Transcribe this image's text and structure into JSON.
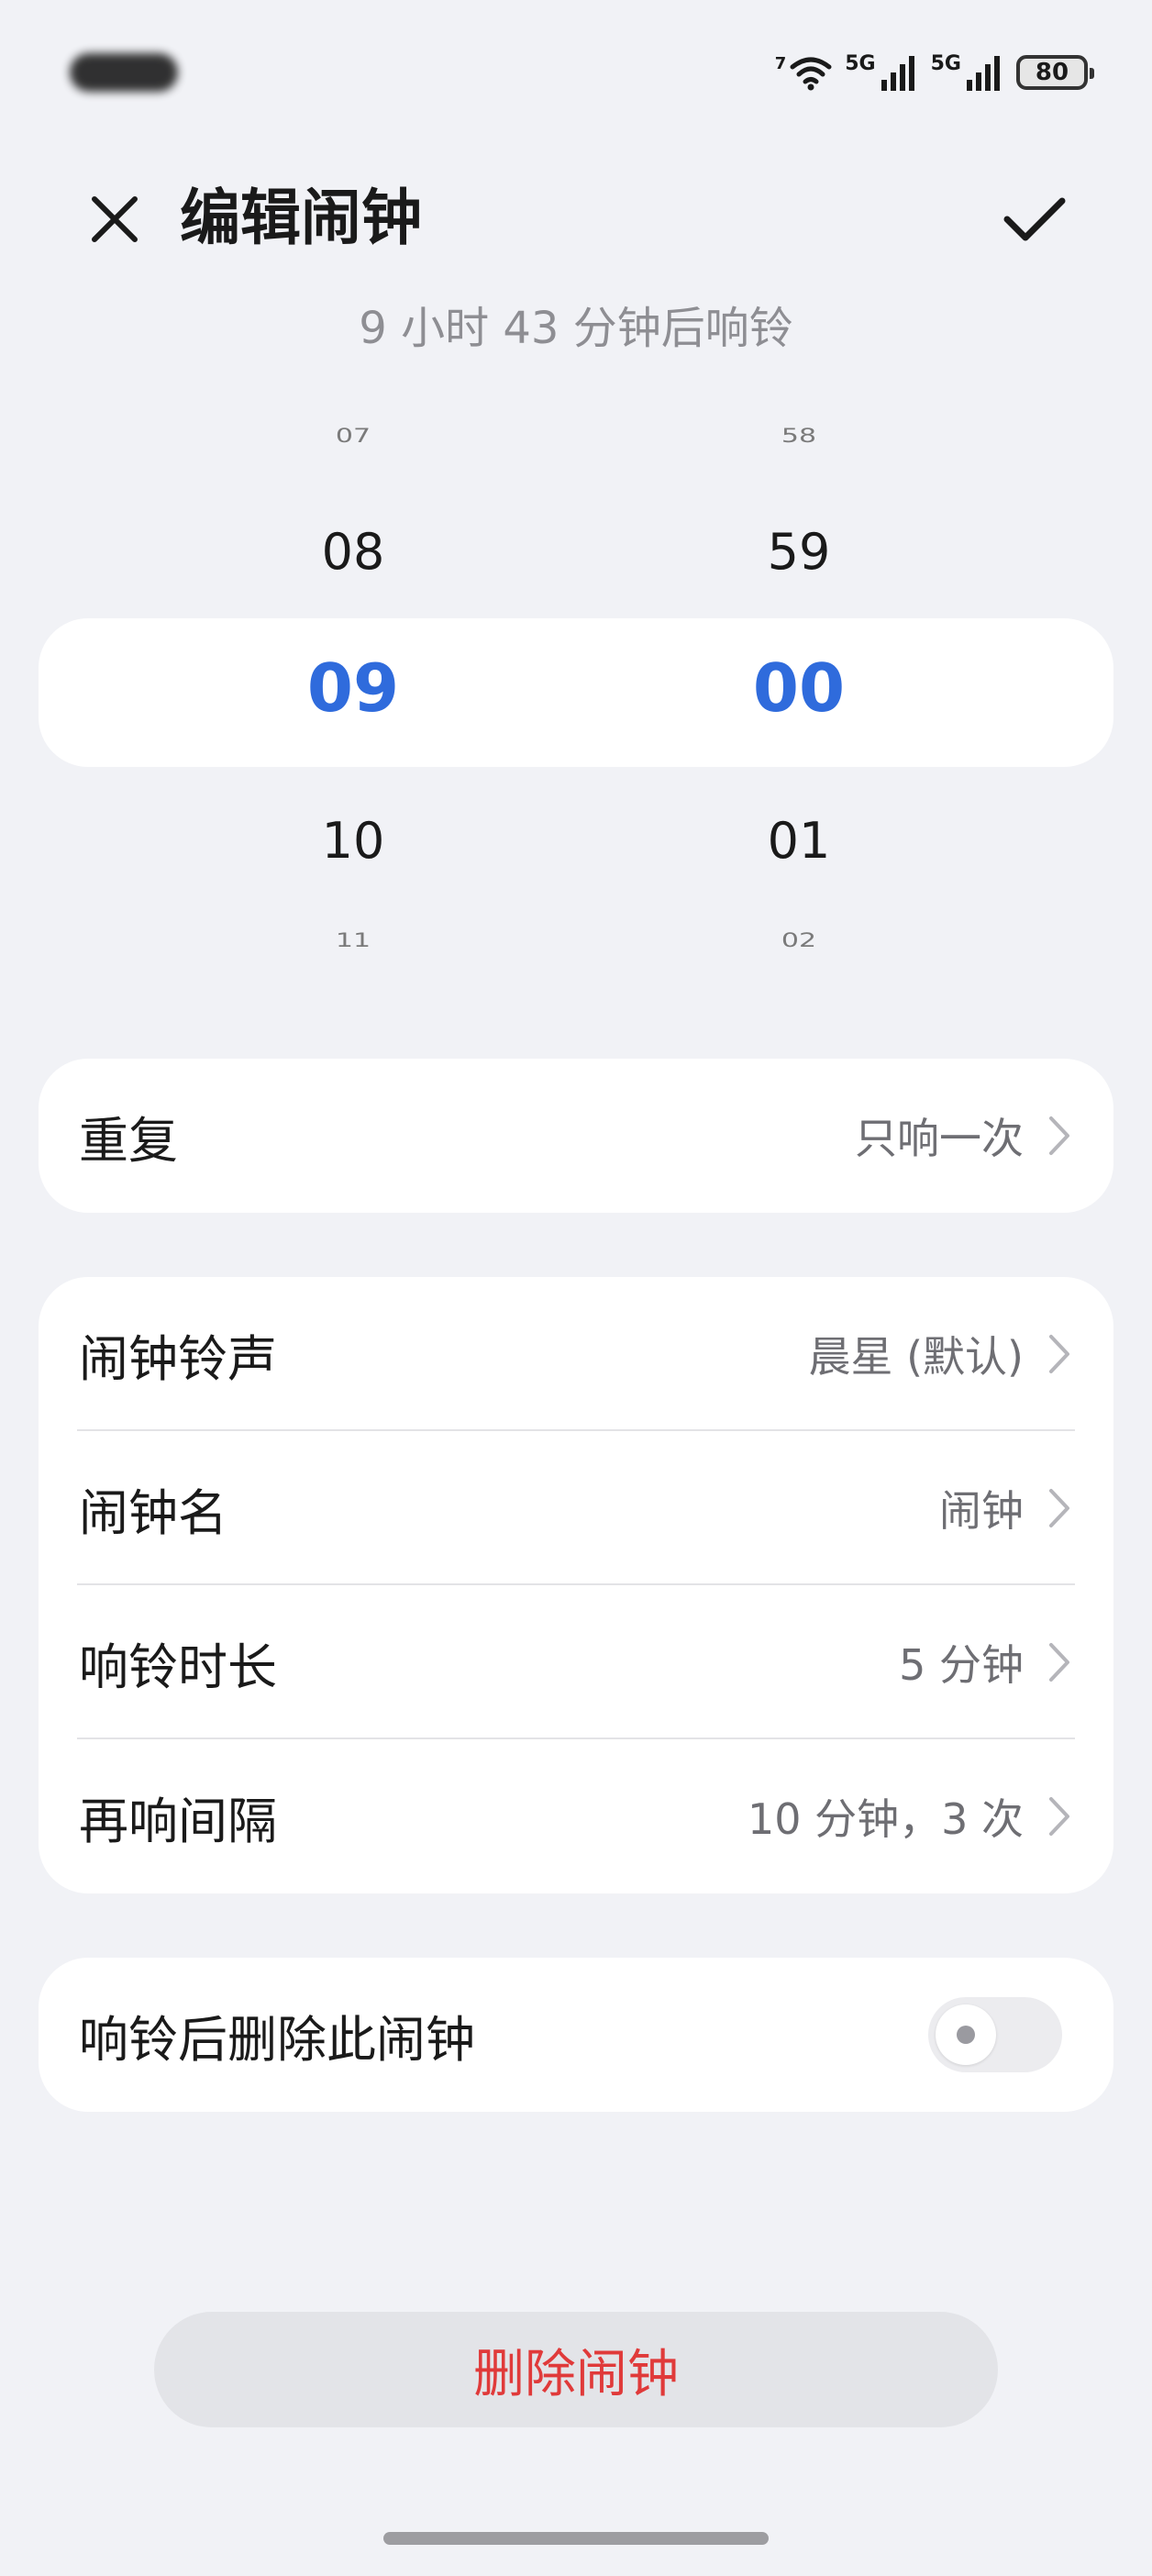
{
  "status_bar": {
    "battery": "80",
    "wifi_badge": "7",
    "sim1_label": "5G",
    "sim2_label": "5G",
    "icons": [
      "wifi-icon",
      "signal-icon",
      "signal-icon",
      "battery-icon"
    ]
  },
  "header": {
    "title": "编辑闹钟",
    "close_icon": "close-icon",
    "confirm_icon": "check-icon"
  },
  "countdown": "9 小时 43 分钟后响铃",
  "picker": {
    "hours": [
      "07",
      "08",
      "09",
      "10",
      "11"
    ],
    "minutes": [
      "58",
      "59",
      "00",
      "01",
      "02"
    ],
    "selected_hour": "09",
    "selected_minute": "00"
  },
  "repeat": {
    "label": "重复",
    "value": "只响一次"
  },
  "settings": {
    "ringtone": {
      "label": "闹钟铃声",
      "value": "晨星 (默认)"
    },
    "name": {
      "label": "闹钟名",
      "value": "闹钟"
    },
    "duration": {
      "label": "响铃时长",
      "value": "5 分钟"
    },
    "snooze": {
      "label": "再响间隔",
      "value": "10 分钟，3 次"
    }
  },
  "delete_after": {
    "label": "响铃后删除此闹钟",
    "enabled": false
  },
  "delete_button": "删除闹钟",
  "colors": {
    "accent": "#2f6bdc",
    "danger": "#e03a3a",
    "background": "#f1f2f6",
    "card": "#ffffff"
  }
}
